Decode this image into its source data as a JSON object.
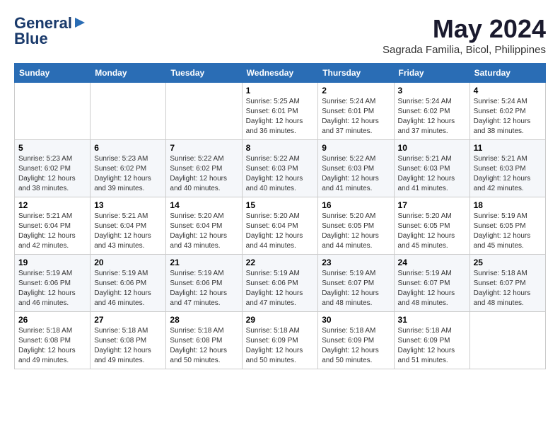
{
  "logo": {
    "line1": "General",
    "line2": "Blue"
  },
  "title": {
    "month_year": "May 2024",
    "location": "Sagrada Familia, Bicol, Philippines"
  },
  "weekdays": [
    "Sunday",
    "Monday",
    "Tuesday",
    "Wednesday",
    "Thursday",
    "Friday",
    "Saturday"
  ],
  "weeks": [
    [
      {
        "day": "",
        "sunrise": "",
        "sunset": "",
        "daylight": ""
      },
      {
        "day": "",
        "sunrise": "",
        "sunset": "",
        "daylight": ""
      },
      {
        "day": "",
        "sunrise": "",
        "sunset": "",
        "daylight": ""
      },
      {
        "day": "1",
        "sunrise": "Sunrise: 5:25 AM",
        "sunset": "Sunset: 6:01 PM",
        "daylight": "Daylight: 12 hours and 36 minutes."
      },
      {
        "day": "2",
        "sunrise": "Sunrise: 5:24 AM",
        "sunset": "Sunset: 6:01 PM",
        "daylight": "Daylight: 12 hours and 37 minutes."
      },
      {
        "day": "3",
        "sunrise": "Sunrise: 5:24 AM",
        "sunset": "Sunset: 6:02 PM",
        "daylight": "Daylight: 12 hours and 37 minutes."
      },
      {
        "day": "4",
        "sunrise": "Sunrise: 5:24 AM",
        "sunset": "Sunset: 6:02 PM",
        "daylight": "Daylight: 12 hours and 38 minutes."
      }
    ],
    [
      {
        "day": "5",
        "sunrise": "Sunrise: 5:23 AM",
        "sunset": "Sunset: 6:02 PM",
        "daylight": "Daylight: 12 hours and 38 minutes."
      },
      {
        "day": "6",
        "sunrise": "Sunrise: 5:23 AM",
        "sunset": "Sunset: 6:02 PM",
        "daylight": "Daylight: 12 hours and 39 minutes."
      },
      {
        "day": "7",
        "sunrise": "Sunrise: 5:22 AM",
        "sunset": "Sunset: 6:02 PM",
        "daylight": "Daylight: 12 hours and 40 minutes."
      },
      {
        "day": "8",
        "sunrise": "Sunrise: 5:22 AM",
        "sunset": "Sunset: 6:03 PM",
        "daylight": "Daylight: 12 hours and 40 minutes."
      },
      {
        "day": "9",
        "sunrise": "Sunrise: 5:22 AM",
        "sunset": "Sunset: 6:03 PM",
        "daylight": "Daylight: 12 hours and 41 minutes."
      },
      {
        "day": "10",
        "sunrise": "Sunrise: 5:21 AM",
        "sunset": "Sunset: 6:03 PM",
        "daylight": "Daylight: 12 hours and 41 minutes."
      },
      {
        "day": "11",
        "sunrise": "Sunrise: 5:21 AM",
        "sunset": "Sunset: 6:03 PM",
        "daylight": "Daylight: 12 hours and 42 minutes."
      }
    ],
    [
      {
        "day": "12",
        "sunrise": "Sunrise: 5:21 AM",
        "sunset": "Sunset: 6:04 PM",
        "daylight": "Daylight: 12 hours and 42 minutes."
      },
      {
        "day": "13",
        "sunrise": "Sunrise: 5:21 AM",
        "sunset": "Sunset: 6:04 PM",
        "daylight": "Daylight: 12 hours and 43 minutes."
      },
      {
        "day": "14",
        "sunrise": "Sunrise: 5:20 AM",
        "sunset": "Sunset: 6:04 PM",
        "daylight": "Daylight: 12 hours and 43 minutes."
      },
      {
        "day": "15",
        "sunrise": "Sunrise: 5:20 AM",
        "sunset": "Sunset: 6:04 PM",
        "daylight": "Daylight: 12 hours and 44 minutes."
      },
      {
        "day": "16",
        "sunrise": "Sunrise: 5:20 AM",
        "sunset": "Sunset: 6:05 PM",
        "daylight": "Daylight: 12 hours and 44 minutes."
      },
      {
        "day": "17",
        "sunrise": "Sunrise: 5:20 AM",
        "sunset": "Sunset: 6:05 PM",
        "daylight": "Daylight: 12 hours and 45 minutes."
      },
      {
        "day": "18",
        "sunrise": "Sunrise: 5:19 AM",
        "sunset": "Sunset: 6:05 PM",
        "daylight": "Daylight: 12 hours and 45 minutes."
      }
    ],
    [
      {
        "day": "19",
        "sunrise": "Sunrise: 5:19 AM",
        "sunset": "Sunset: 6:06 PM",
        "daylight": "Daylight: 12 hours and 46 minutes."
      },
      {
        "day": "20",
        "sunrise": "Sunrise: 5:19 AM",
        "sunset": "Sunset: 6:06 PM",
        "daylight": "Daylight: 12 hours and 46 minutes."
      },
      {
        "day": "21",
        "sunrise": "Sunrise: 5:19 AM",
        "sunset": "Sunset: 6:06 PM",
        "daylight": "Daylight: 12 hours and 47 minutes."
      },
      {
        "day": "22",
        "sunrise": "Sunrise: 5:19 AM",
        "sunset": "Sunset: 6:06 PM",
        "daylight": "Daylight: 12 hours and 47 minutes."
      },
      {
        "day": "23",
        "sunrise": "Sunrise: 5:19 AM",
        "sunset": "Sunset: 6:07 PM",
        "daylight": "Daylight: 12 hours and 48 minutes."
      },
      {
        "day": "24",
        "sunrise": "Sunrise: 5:19 AM",
        "sunset": "Sunset: 6:07 PM",
        "daylight": "Daylight: 12 hours and 48 minutes."
      },
      {
        "day": "25",
        "sunrise": "Sunrise: 5:18 AM",
        "sunset": "Sunset: 6:07 PM",
        "daylight": "Daylight: 12 hours and 48 minutes."
      }
    ],
    [
      {
        "day": "26",
        "sunrise": "Sunrise: 5:18 AM",
        "sunset": "Sunset: 6:08 PM",
        "daylight": "Daylight: 12 hours and 49 minutes."
      },
      {
        "day": "27",
        "sunrise": "Sunrise: 5:18 AM",
        "sunset": "Sunset: 6:08 PM",
        "daylight": "Daylight: 12 hours and 49 minutes."
      },
      {
        "day": "28",
        "sunrise": "Sunrise: 5:18 AM",
        "sunset": "Sunset: 6:08 PM",
        "daylight": "Daylight: 12 hours and 50 minutes."
      },
      {
        "day": "29",
        "sunrise": "Sunrise: 5:18 AM",
        "sunset": "Sunset: 6:09 PM",
        "daylight": "Daylight: 12 hours and 50 minutes."
      },
      {
        "day": "30",
        "sunrise": "Sunrise: 5:18 AM",
        "sunset": "Sunset: 6:09 PM",
        "daylight": "Daylight: 12 hours and 50 minutes."
      },
      {
        "day": "31",
        "sunrise": "Sunrise: 5:18 AM",
        "sunset": "Sunset: 6:09 PM",
        "daylight": "Daylight: 12 hours and 51 minutes."
      },
      {
        "day": "",
        "sunrise": "",
        "sunset": "",
        "daylight": ""
      }
    ]
  ]
}
